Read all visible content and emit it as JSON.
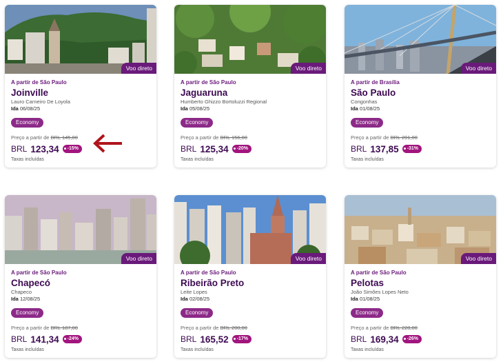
{
  "cards": [
    {
      "origin": "A partir de São Paulo",
      "city": "Joinville",
      "airport": "Lauro Carneiro De Loyola",
      "date_label": "Ida",
      "date": "06/08/25",
      "badge": "Voo direto",
      "fare": "Economy",
      "from_label": "Preço a partir de",
      "old_price": "BRL 145,00",
      "currency": "BRL",
      "price": "123,34",
      "discount": "-15%",
      "taxes": "Taxas incluídas"
    },
    {
      "origin": "A partir de São Paulo",
      "city": "Jaguaruna",
      "airport": "Humberto Ghizzo Bortoluzzi Regional",
      "date_label": "Ida",
      "date": "05/08/25",
      "badge": "Voo direto",
      "fare": "Economy",
      "from_label": "Preço a partir de",
      "old_price": "BRL 156,00",
      "currency": "BRL",
      "price": "125,34",
      "discount": "-20%",
      "taxes": "Taxas incluídas"
    },
    {
      "origin": "A partir de Brasília",
      "city": "São Paulo",
      "airport": "Congonhas",
      "date_label": "Ida",
      "date": "01/08/25",
      "badge": "Voo direto",
      "fare": "Economy",
      "from_label": "Preço a partir de",
      "old_price": "BRL 201,00",
      "currency": "BRL",
      "price": "137,85",
      "discount": "-31%",
      "taxes": "Taxas incluídas"
    },
    {
      "origin": "A partir de São Paulo",
      "city": "Chapecó",
      "airport": "Chapeco",
      "date_label": "Ida",
      "date": "12/08/25",
      "badge": "Voo direto",
      "fare": "Economy",
      "from_label": "Preço a partir de",
      "old_price": "BRL 187,00",
      "currency": "BRL",
      "price": "141,34",
      "discount": "-24%",
      "taxes": "Taxas incluídas"
    },
    {
      "origin": "A partir de São Paulo",
      "city": "Ribeirão Preto",
      "airport": "Leite Lopes",
      "date_label": "Ida",
      "date": "02/08/25",
      "badge": "Voo direto",
      "fare": "Economy",
      "from_label": "Preço a partir de",
      "old_price": "BRL 200,00",
      "currency": "BRL",
      "price": "165,52",
      "discount": "-17%",
      "taxes": "Taxas incluídas"
    },
    {
      "origin": "A partir de São Paulo",
      "city": "Pelotas",
      "airport": "João Simões Lopes Neto",
      "date_label": "Ida",
      "date": "01/08/25",
      "badge": "Voo direto",
      "fare": "Economy",
      "from_label": "Preço a partir de",
      "old_price": "BRL 228,00",
      "currency": "BRL",
      "price": "169,34",
      "discount": "-26%",
      "taxes": "Taxas incluídas"
    }
  ],
  "colors": {
    "brand_purple": "#3d0a52",
    "badge_purple": "#6a1a7a",
    "discount_magenta": "#a1157e",
    "arrow_red": "#b0141c"
  },
  "icons": [
    "red-arrow-icon",
    "discount-tag-icon"
  ]
}
